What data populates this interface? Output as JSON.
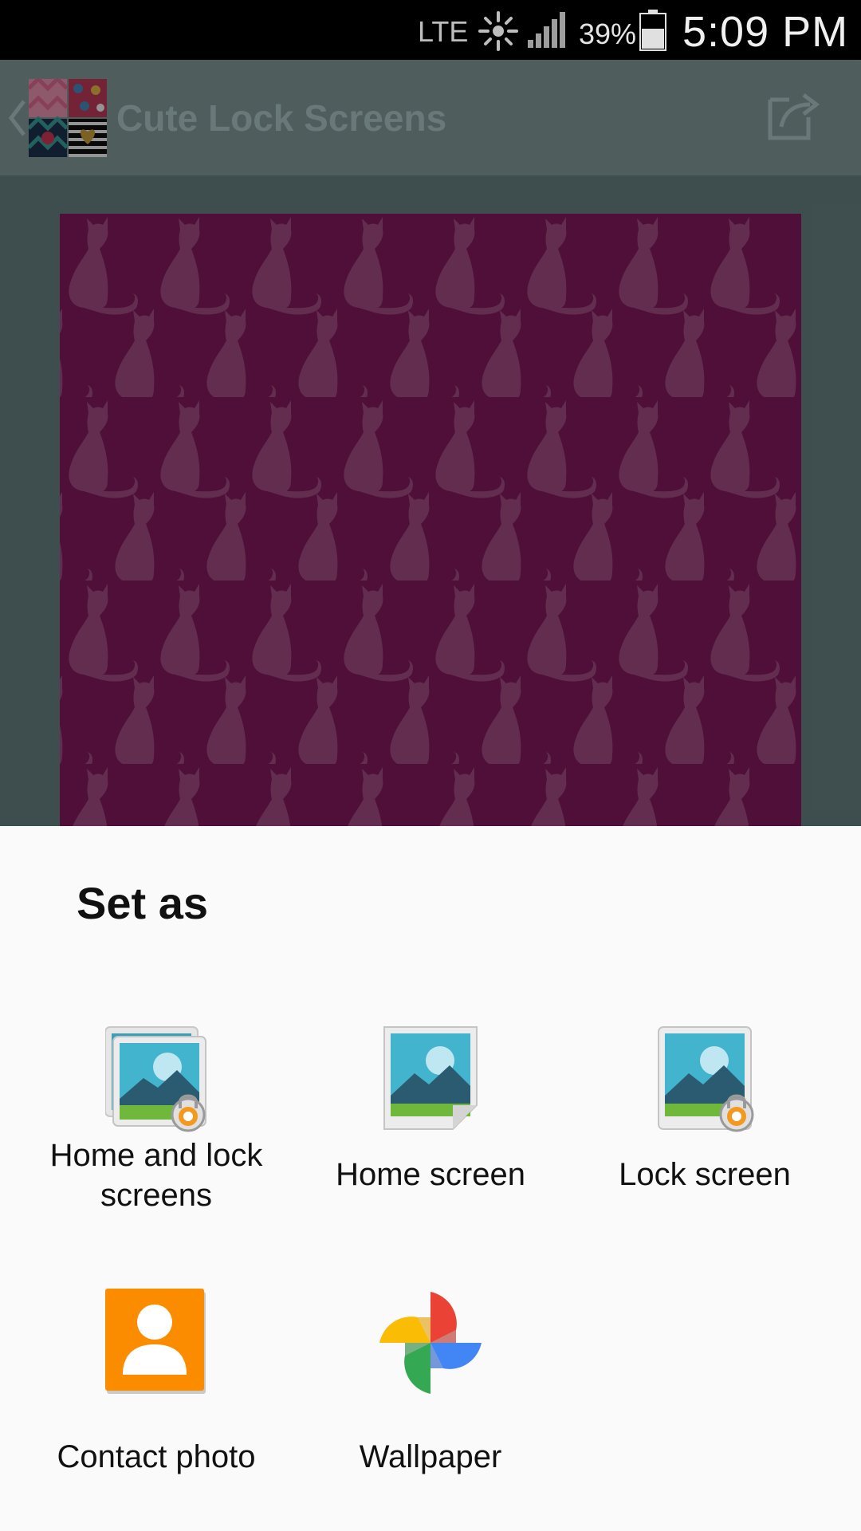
{
  "status_bar": {
    "network": "LTE",
    "battery_percent": "39%",
    "time": "5:09 PM",
    "icons": [
      "data-activity-icon",
      "signal-icon",
      "battery-icon"
    ]
  },
  "app_bar": {
    "title": "Cute Lock Screens",
    "icons": [
      "back-chevron-icon",
      "app-logo",
      "share-icon"
    ]
  },
  "preview": {
    "pattern": "cat-silhouettes",
    "background_color": "#8a1a61",
    "pattern_color": "#c27aa8"
  },
  "sheet": {
    "title": "Set as",
    "options": [
      {
        "label": "Home and lock screens",
        "icon": "home-and-lock-screens-icon"
      },
      {
        "label": "Home screen",
        "icon": "home-screen-icon"
      },
      {
        "label": "Lock screen",
        "icon": "lock-screen-icon"
      },
      {
        "label": "Contact photo",
        "icon": "contact-photo-icon"
      },
      {
        "label": "Wallpaper",
        "icon": "google-photos-pinwheel-icon"
      }
    ]
  }
}
